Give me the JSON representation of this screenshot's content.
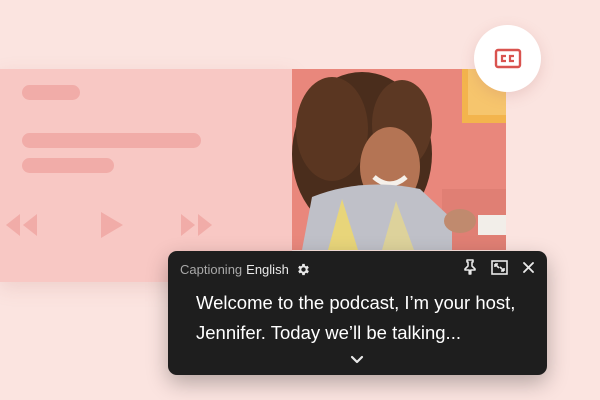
{
  "caption": {
    "app_label": "Captioning",
    "language": "English",
    "text": "Welcome to the podcast, I’m your host, Jennifer. Today we’ll be talking..."
  },
  "icons": {
    "cc": "closed-captions-icon",
    "settings": "gear-icon",
    "pin": "pin-icon",
    "resize": "resize-icon",
    "close": "close-icon",
    "expand": "chevron-down-icon",
    "rewind": "rewind-icon",
    "play": "play-icon",
    "fast_forward": "fast-forward-icon"
  },
  "colors": {
    "background": "#fbe4e0",
    "player_card": "#f8c8c4",
    "skeleton": "#f1aca8",
    "accent": "#d9534f",
    "caption_panel": "#1e1e1e"
  }
}
